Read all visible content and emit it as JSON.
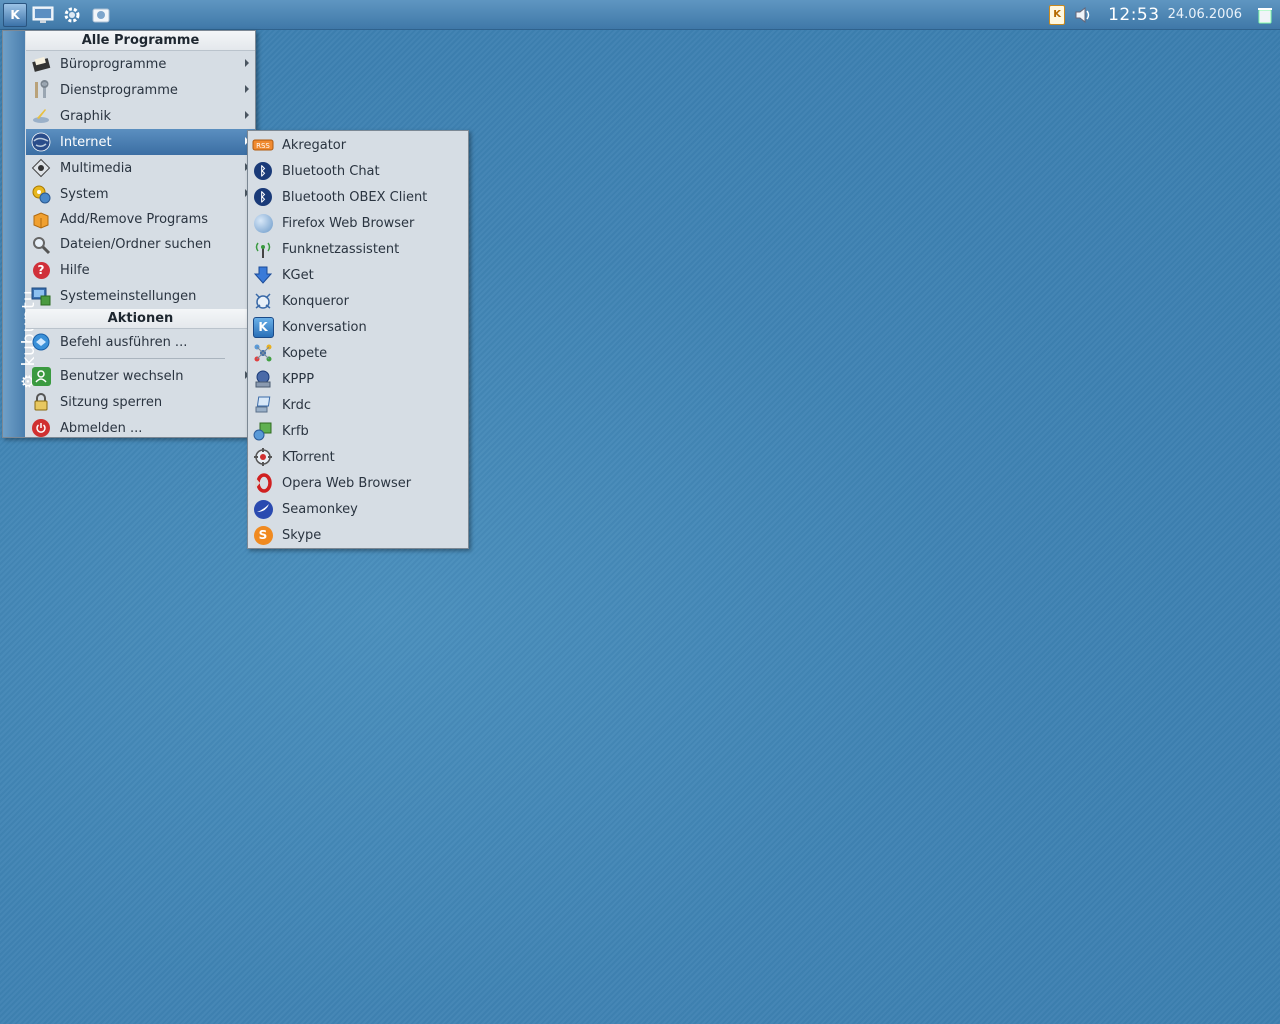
{
  "panel": {
    "kmenu_button_label": "K",
    "clock": {
      "time": "12:53",
      "date": "24.06.2006"
    },
    "klipper_label": "K"
  },
  "sidebar": {
    "brand": "kubuntu"
  },
  "kmenu": {
    "programs_title": "Alle Programme",
    "programs": [
      {
        "label": "Büroprogramme",
        "icon": "office-icon",
        "submenu": true
      },
      {
        "label": "Dienstprogramme",
        "icon": "utilities-icon",
        "submenu": true
      },
      {
        "label": "Graphik",
        "icon": "graphics-icon",
        "submenu": true
      },
      {
        "label": "Internet",
        "icon": "internet-globe-icon",
        "submenu": true,
        "selected": true
      },
      {
        "label": "Multimedia",
        "icon": "multimedia-icon",
        "submenu": true
      },
      {
        "label": "System",
        "icon": "system-icon",
        "submenu": true
      },
      {
        "label": "Add/Remove Programs",
        "icon": "package-icon",
        "submenu": false
      },
      {
        "label": "Dateien/Ordner suchen",
        "icon": "search-icon",
        "submenu": false
      },
      {
        "label": "Hilfe",
        "icon": "help-icon",
        "submenu": false
      },
      {
        "label": "Systemeinstellungen",
        "icon": "settings-icon",
        "submenu": false
      }
    ],
    "actions_title": "Aktionen",
    "actions": [
      {
        "label": "Befehl ausführen ...",
        "icon": "run-command-icon",
        "submenu": false
      },
      {
        "label": "Benutzer wechseln",
        "icon": "switch-user-icon",
        "submenu": true
      },
      {
        "label": "Sitzung sperren",
        "icon": "lock-icon",
        "submenu": false
      },
      {
        "label": "Abmelden ...",
        "icon": "logout-icon",
        "submenu": false
      }
    ]
  },
  "internet_submenu": {
    "items": [
      {
        "label": "Akregator",
        "icon": "rss-icon"
      },
      {
        "label": "Bluetooth Chat",
        "icon": "bluetooth-icon"
      },
      {
        "label": "Bluetooth OBEX Client",
        "icon": "bluetooth-icon"
      },
      {
        "label": "Firefox Web Browser",
        "icon": "firefox-icon"
      },
      {
        "label": "Funknetzassistent",
        "icon": "wireless-icon"
      },
      {
        "label": "KGet",
        "icon": "download-arrow-icon"
      },
      {
        "label": "Konqueror",
        "icon": "konqueror-icon"
      },
      {
        "label": "Konversation",
        "icon": "konversation-icon"
      },
      {
        "label": "Kopete",
        "icon": "kopete-icon"
      },
      {
        "label": "KPPP",
        "icon": "modem-icon"
      },
      {
        "label": "Krdc",
        "icon": "remote-desktop-icon"
      },
      {
        "label": "Krfb",
        "icon": "desktop-sharing-icon"
      },
      {
        "label": "KTorrent",
        "icon": "torrent-icon"
      },
      {
        "label": "Opera Web Browser",
        "icon": "opera-icon"
      },
      {
        "label": "Seamonkey",
        "icon": "seamonkey-icon"
      },
      {
        "label": "Skype",
        "icon": "skype-icon"
      }
    ]
  },
  "colors": {
    "desktop": "#4286b6",
    "menu_bg": "#d6dde4",
    "selection": "#3b6ea3"
  }
}
